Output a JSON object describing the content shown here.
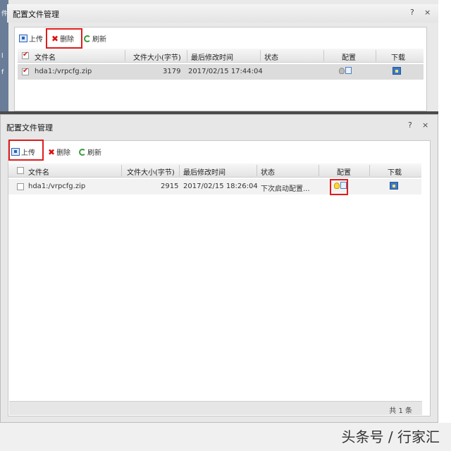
{
  "top_window": {
    "title": "配置文件管理",
    "help": "?",
    "close": "×",
    "background_chars": [
      "件",
      "l",
      "f"
    ],
    "toolbar": {
      "upload": "上传",
      "delete": "删除",
      "refresh": "刷新"
    },
    "columns": [
      "文件名",
      "文件大小(字节)",
      "最后修改时间",
      "状态",
      "配置",
      "下载"
    ],
    "rows": [
      {
        "name": "hda1:/vrpcfg.zip",
        "size": "3179",
        "modified": "2017/02/15 17:44:04",
        "status": ""
      }
    ]
  },
  "main_window": {
    "title": "配置文件管理",
    "help": "?",
    "close": "×",
    "toolbar": {
      "upload": "上传",
      "delete": "删除",
      "refresh": "刷新"
    },
    "columns": [
      "文件名",
      "文件大小(字节)",
      "最后修改时间",
      "状态",
      "配置",
      "下载"
    ],
    "rows": [
      {
        "name": "hda1:/vrpcfg.zip",
        "size": "2915",
        "modified": "2017/02/15 18:26:04",
        "status": "下次启动配置..."
      }
    ],
    "footer": "共 1 条"
  },
  "watermark": "头条号 / 行家汇",
  "colors": {
    "highlight": "#e01c1c",
    "checked": "#c22222"
  }
}
